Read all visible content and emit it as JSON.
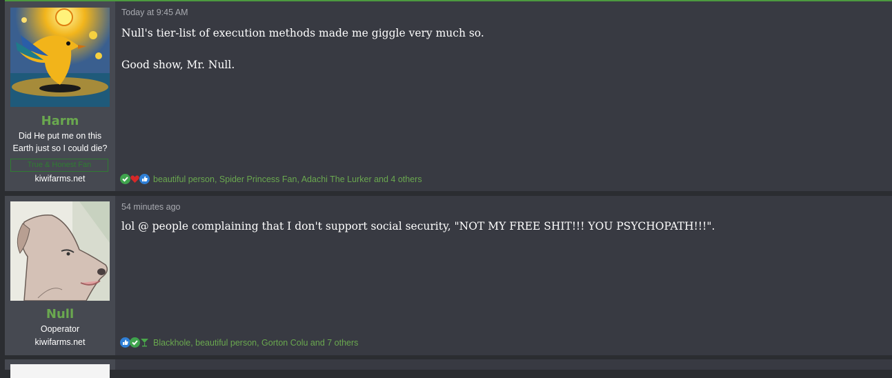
{
  "posts": [
    {
      "username": "Harm",
      "user_title_line1": "Did He put me on this",
      "user_title_line2": "Earth just so I could die?",
      "banner": "True & Honest Fan",
      "site": "kiwifarms.net",
      "timestamp": "Today at 9:45 AM",
      "body_line1": "Null's tier-list of execution methods made me giggle very much so.",
      "body_line2": "Good show, Mr. Null.",
      "reactions_text": "beautiful person, Spider Princess Fan, Adachi The Lurker and 4 others",
      "reaction_icons": [
        "check-icon",
        "heart-icon",
        "thumbs-up-icon"
      ]
    },
    {
      "username": "Null",
      "user_title_line1": "Ooperator",
      "site": "kiwifarms.net",
      "timestamp": "54 minutes ago",
      "body_line1": "lol @ people complaining that I don't support social security, \"NOT MY FREE SHIT!!! YOU PSYCHOPATH!!!\".",
      "reactions_text": "Blackhole, beautiful person, Gorton Colu and 7 others",
      "reaction_icons": [
        "thumbs-up-icon",
        "check-icon",
        "cocktail-icon"
      ]
    }
  ],
  "colors": {
    "accent_green": "#6aa84f",
    "post_bg": "#383a42",
    "sidebar_bg": "#464951",
    "page_bg": "#2b2d31"
  }
}
